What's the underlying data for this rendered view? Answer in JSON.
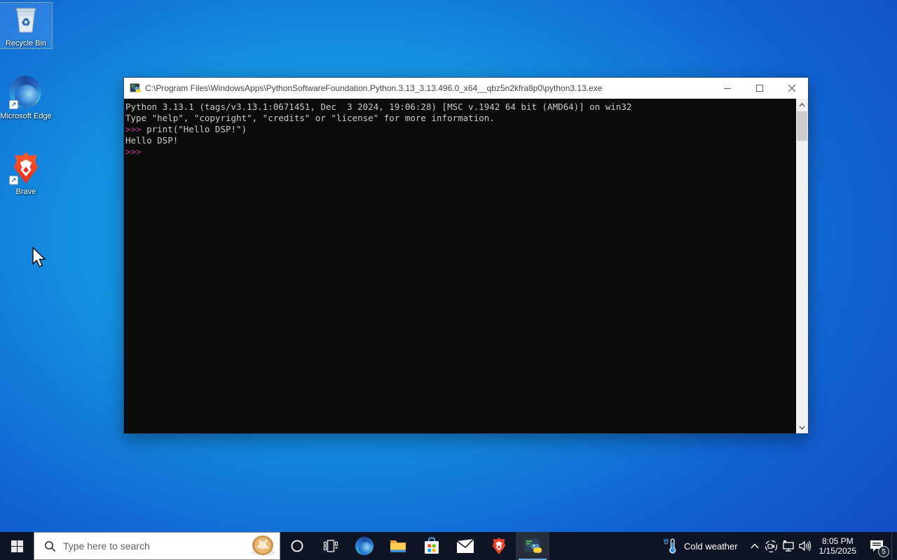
{
  "desktop": {
    "icons": [
      {
        "label": "Recycle Bin",
        "selected": true
      },
      {
        "label": "Microsoft Edge",
        "selected": false
      },
      {
        "label": "Brave",
        "selected": false
      }
    ]
  },
  "window": {
    "title": "C:\\Program Files\\WindowsApps\\PythonSoftwareFoundation.Python.3.13_3.13.496.0_x64__qbz5n2kfra8p0\\python3.13.exe",
    "controls": {
      "minimize": "minimize",
      "maximize": "maximize",
      "close": "close"
    },
    "console": {
      "line1": "Python 3.13.1 (tags/v3.13.1:0671451, Dec  3 2024, 19:06:28) [MSC v.1942 64 bit (AMD64)] on win32",
      "line2": "Type \"help\", \"copyright\", \"credits\" or \"license\" for more information.",
      "prompt": ">>>",
      "command": " print(\"Hello DSP!\")",
      "output_text": "Hello DSP!",
      "colors": {
        "background": "#0c0c0c",
        "text": "#cccccc",
        "prompt": "#c73c9b"
      }
    }
  },
  "taskbar": {
    "search_placeholder": "Type here to search",
    "app_icons": [
      "start",
      "cortana",
      "task-view",
      "edge",
      "file-explorer",
      "microsoft-store",
      "mail",
      "brave",
      "python-console"
    ],
    "active_app": "python-console",
    "weather_label": "Cold weather",
    "tray_icons": [
      "hidden-icons-chevron",
      "meet-now",
      "network",
      "volume"
    ],
    "clock_time": "8:05 PM",
    "clock_date": "1/15/2025",
    "notification_count": "5",
    "colors": {
      "bar": "#0f1524",
      "active_underline": "#69a8dc"
    }
  }
}
